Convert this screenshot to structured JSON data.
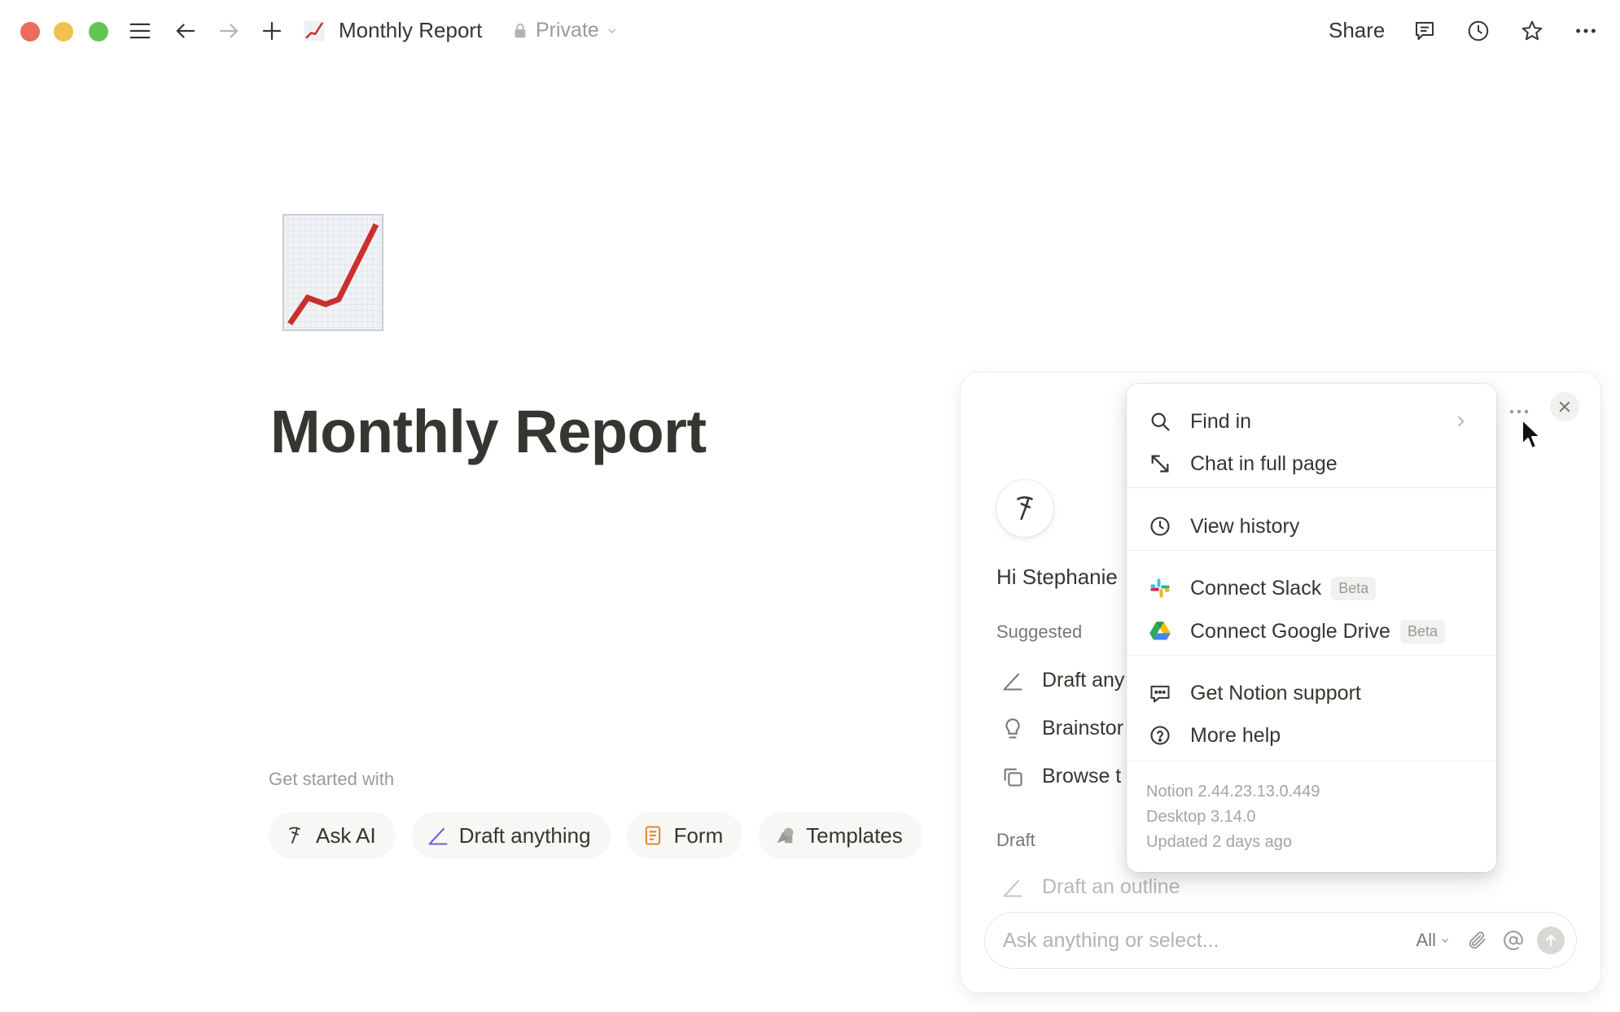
{
  "topbar": {
    "page_title": "Monthly Report",
    "privacy": "Private",
    "share_label": "Share"
  },
  "page": {
    "title": "Monthly Report",
    "icon": "chart-increasing-icon",
    "get_started_label": "Get started with",
    "chips": [
      {
        "label": "Ask AI",
        "icon": "notion-ai-icon"
      },
      {
        "label": "Draft anything",
        "icon": "pen-icon"
      },
      {
        "label": "Form",
        "icon": "form-icon"
      },
      {
        "label": "Templates",
        "icon": "templates-icon"
      }
    ]
  },
  "ai_panel": {
    "greeting": "Hi Stephanie",
    "suggested_label": "Suggested",
    "suggested_items": [
      "Draft any",
      "Brainstor",
      "Browse t"
    ],
    "draft_label": "Draft",
    "draft_items": [
      "Draft an outline"
    ],
    "input_placeholder": "Ask anything or select...",
    "scope_label": "All"
  },
  "menu": {
    "items": [
      {
        "label": "Find in",
        "icon": "search-icon"
      },
      {
        "label": "Chat in full page",
        "icon": "expand-icon"
      },
      {
        "label": "View history",
        "icon": "clock-icon"
      },
      {
        "label": "Connect Slack",
        "icon": "slack-icon",
        "badge": "Beta"
      },
      {
        "label": "Connect Google Drive",
        "icon": "google-drive-icon",
        "badge": "Beta"
      },
      {
        "label": "Get Notion support",
        "icon": "chat-bubble-icon"
      },
      {
        "label": "More help",
        "icon": "help-icon"
      }
    ],
    "footer": {
      "version": "Notion 2.44.23.13.0.449",
      "desktop": "Desktop 3.14.0",
      "updated": "Updated 2 days ago"
    }
  },
  "colors": {
    "text": "#37352f",
    "muted": "#9b9a97",
    "chart_red": "#c9302c",
    "traffic_red": "#ed6a5e",
    "traffic_yellow": "#f5bf4f",
    "traffic_green": "#61c554"
  }
}
